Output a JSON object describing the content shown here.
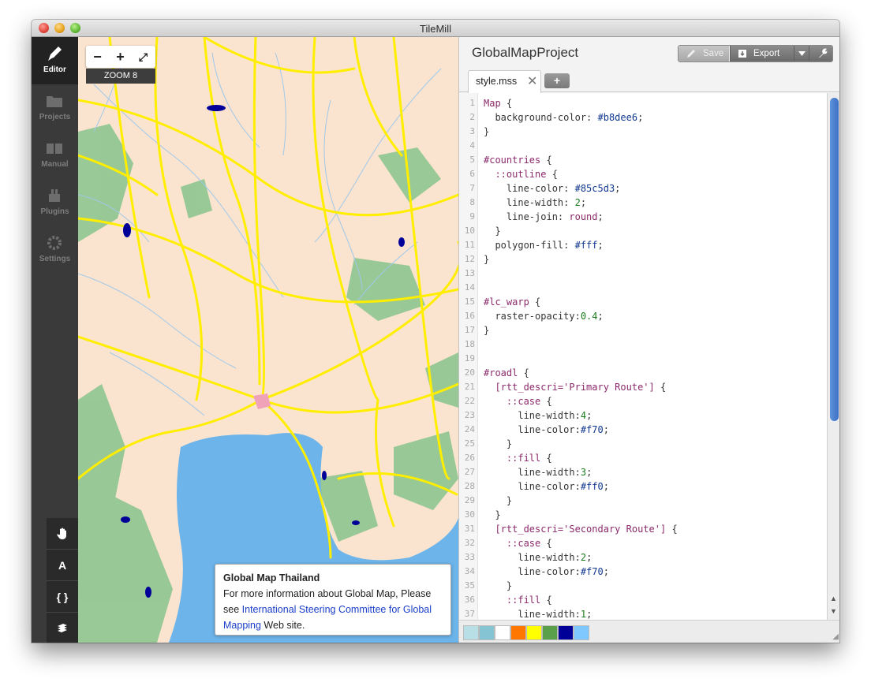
{
  "window": {
    "title": "TileMill"
  },
  "sidebar": {
    "items": [
      {
        "label": "Editor",
        "icon": "pencil-icon"
      },
      {
        "label": "Projects",
        "icon": "folder-icon"
      },
      {
        "label": "Manual",
        "icon": "book-icon"
      },
      {
        "label": "Plugins",
        "icon": "plugin-icon"
      },
      {
        "label": "Settings",
        "icon": "gear-icon"
      }
    ],
    "tools": [
      {
        "icon": "hand-icon",
        "glyph": ""
      },
      {
        "icon": "font-icon",
        "glyph": "A"
      },
      {
        "icon": "braces-icon",
        "glyph": "{ }"
      },
      {
        "icon": "layers-icon",
        "glyph": ""
      }
    ]
  },
  "map": {
    "zoom_out": "−",
    "zoom_in": "+",
    "fullscreen": "⤢",
    "zoom_label": "ZOOM 8",
    "legend": {
      "title": "Global Map Thailand",
      "text_before": "For more information about Global Map, Please see ",
      "link": "International Steering Committee for Global Mapping",
      "text_after": " Web site."
    },
    "colors": {
      "land": "#fbe4cf",
      "water": "#6cb4ea",
      "road": "#ffee00",
      "road_case": "#ff7700",
      "forest": "#7fbf86",
      "lake": "#000099",
      "river": "#9fc8ea"
    }
  },
  "editor": {
    "project_title": "GlobalMapProject",
    "toolbar": {
      "save": "Save",
      "export": "Export"
    },
    "tab": {
      "name": "style.mss",
      "close": "✕",
      "add": "+"
    },
    "code": [
      "Map {",
      "  background-color: #b8dee6;",
      "}",
      "",
      "#countries {",
      "  ::outline {",
      "    line-color: #85c5d3;",
      "    line-width: 2;",
      "    line-join: round;",
      "  }",
      "  polygon-fill: #fff;",
      "}",
      "",
      "",
      "#lc_warp {",
      "  raster-opacity:0.4;",
      "}",
      "",
      "",
      "#roadl {",
      "  [rtt_descri='Primary Route'] {",
      "    ::case {",
      "      line-width:4;",
      "      line-color:#f70;",
      "    }",
      "    ::fill {",
      "      line-width:3;",
      "      line-color:#ff0;",
      "    }",
      "  }",
      "  [rtt_descri='Secondary Route'] {",
      "    ::case {",
      "      line-width:2;",
      "      line-color:#f70;",
      "    }",
      "    ::fill {",
      "      line-width:1;"
    ],
    "swatches": [
      "#b8dee6",
      "#85c5d3",
      "#ffffff",
      "#ff7700",
      "#ffff00",
      "#5aa04a",
      "#000099",
      "#7fc7ff"
    ]
  }
}
